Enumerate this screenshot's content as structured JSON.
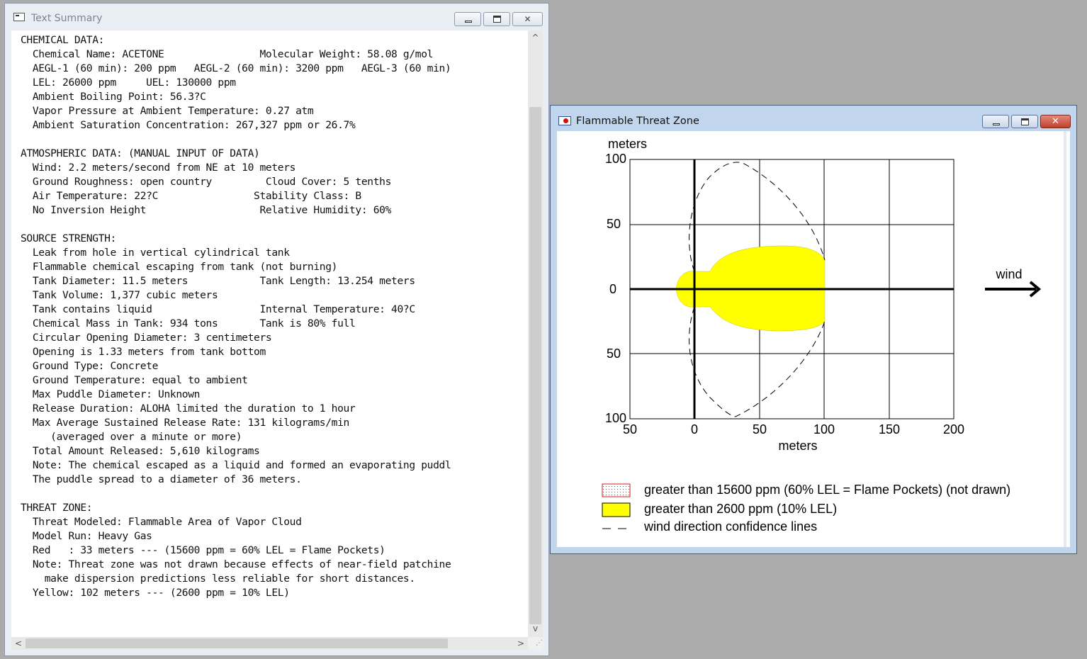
{
  "text_summary": {
    "title": "Text Summary",
    "lines": [
      "CHEMICAL DATA:",
      "  Chemical Name: ACETONE                Molecular Weight: 58.08 g/mol",
      "  AEGL-1 (60 min): 200 ppm   AEGL-2 (60 min): 3200 ppm   AEGL-3 (60 min)",
      "  LEL: 26000 ppm     UEL: 130000 ppm",
      "  Ambient Boiling Point: 56.3?C",
      "  Vapor Pressure at Ambient Temperature: 0.27 atm",
      "  Ambient Saturation Concentration: 267,327 ppm or 26.7%",
      "",
      "ATMOSPHERIC DATA: (MANUAL INPUT OF DATA)",
      "  Wind: 2.2 meters/second from NE at 10 meters",
      "  Ground Roughness: open country         Cloud Cover: 5 tenths",
      "  Air Temperature: 22?C                Stability Class: B",
      "  No Inversion Height                   Relative Humidity: 60%",
      "",
      "SOURCE STRENGTH:",
      "  Leak from hole in vertical cylindrical tank",
      "  Flammable chemical escaping from tank (not burning)",
      "  Tank Diameter: 11.5 meters            Tank Length: 13.254 meters",
      "  Tank Volume: 1,377 cubic meters",
      "  Tank contains liquid                  Internal Temperature: 40?C",
      "  Chemical Mass in Tank: 934 tons       Tank is 80% full",
      "  Circular Opening Diameter: 3 centimeters",
      "  Opening is 1.33 meters from tank bottom",
      "  Ground Type: Concrete",
      "  Ground Temperature: equal to ambient",
      "  Max Puddle Diameter: Unknown",
      "  Release Duration: ALOHA limited the duration to 1 hour",
      "  Max Average Sustained Release Rate: 131 kilograms/min",
      "     (averaged over a minute or more)",
      "  Total Amount Released: 5,610 kilograms",
      "  Note: The chemical escaped as a liquid and formed an evaporating puddl",
      "  The puddle spread to a diameter of 36 meters.",
      "",
      "THREAT ZONE:",
      "  Threat Modeled: Flammable Area of Vapor Cloud",
      "  Model Run: Heavy Gas",
      "  Red   : 33 meters --- (15600 ppm = 60% LEL = Flame Pockets)",
      "  Note: Threat zone was not drawn because effects of near-field patchine",
      "    make dispersion predictions less reliable for short distances.",
      "  Yellow: 102 meters --- (2600 ppm = 10% LEL)"
    ]
  },
  "threat_zone": {
    "title": "Flammable Threat Zone",
    "close_glyph": "✕",
    "y_unit_label": "meters",
    "x_axis_label": "meters",
    "y_tick_labels": [
      "100",
      "50",
      "0",
      "50",
      "100"
    ],
    "x_tick_labels": [
      "50",
      "0",
      "50",
      "100",
      "150",
      "200"
    ],
    "wind_label": "wind",
    "legend": [
      {
        "label": "greater than 15600 ppm (60% LEL = Flame Pockets) (not drawn)",
        "swatch": "red-dotted"
      },
      {
        "label": "greater than 2600 ppm (10% LEL)",
        "swatch": "#ffff00"
      },
      {
        "label": "wind direction confidence lines",
        "swatch": "dashed"
      }
    ],
    "zone_color": "#ffff00"
  },
  "scroll": {
    "up": "^",
    "down": "v",
    "left": "<",
    "right": ">"
  }
}
